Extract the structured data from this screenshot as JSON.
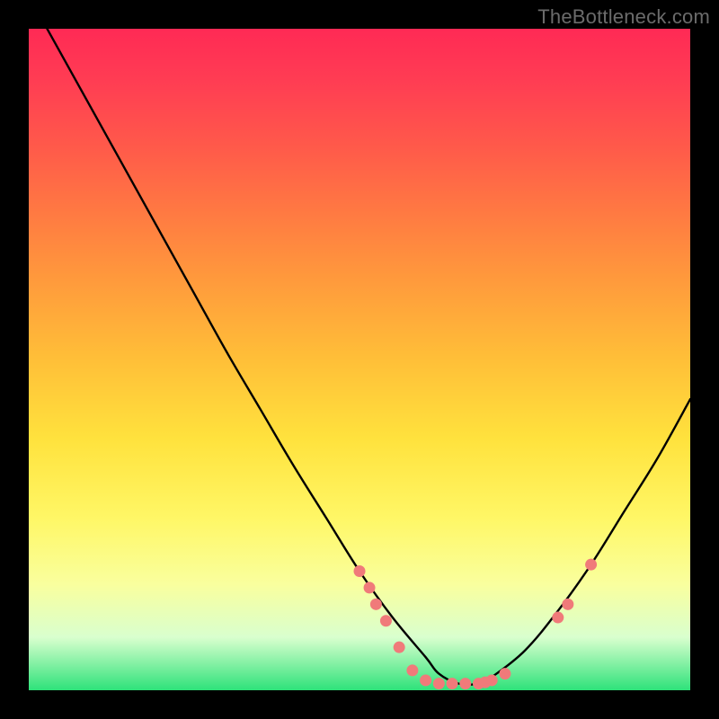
{
  "watermark": "TheBottleneck.com",
  "chart_data": {
    "type": "line",
    "title": "",
    "xlabel": "",
    "ylabel": "",
    "xlim": [
      0,
      100
    ],
    "ylim": [
      0,
      100
    ],
    "series": [
      {
        "name": "curve",
        "x": [
          0,
          5,
          10,
          15,
          20,
          25,
          30,
          35,
          40,
          45,
          50,
          55,
          60,
          62,
          65,
          68,
          70,
          75,
          80,
          85,
          90,
          95,
          100
        ],
        "y": [
          105,
          96,
          87,
          78,
          69,
          60,
          51,
          42.5,
          34,
          26,
          18,
          11,
          5,
          2.5,
          1,
          1,
          2,
          6,
          12,
          19,
          27,
          35,
          44
        ]
      }
    ],
    "markers": [
      {
        "x": 50,
        "y": 18
      },
      {
        "x": 51.5,
        "y": 15.5
      },
      {
        "x": 52.5,
        "y": 13
      },
      {
        "x": 54,
        "y": 10.5
      },
      {
        "x": 56,
        "y": 6.5
      },
      {
        "x": 58,
        "y": 3
      },
      {
        "x": 60,
        "y": 1.5
      },
      {
        "x": 62,
        "y": 1
      },
      {
        "x": 64,
        "y": 1
      },
      {
        "x": 66,
        "y": 1
      },
      {
        "x": 68,
        "y": 1
      },
      {
        "x": 69,
        "y": 1.2
      },
      {
        "x": 70,
        "y": 1.5
      },
      {
        "x": 72,
        "y": 2.5
      },
      {
        "x": 80,
        "y": 11
      },
      {
        "x": 81.5,
        "y": 13
      },
      {
        "x": 85,
        "y": 19
      }
    ],
    "background_gradient": {
      "top": "#ff2a55",
      "mid": "#ffe23d",
      "bottom": "#2ee27a"
    }
  }
}
